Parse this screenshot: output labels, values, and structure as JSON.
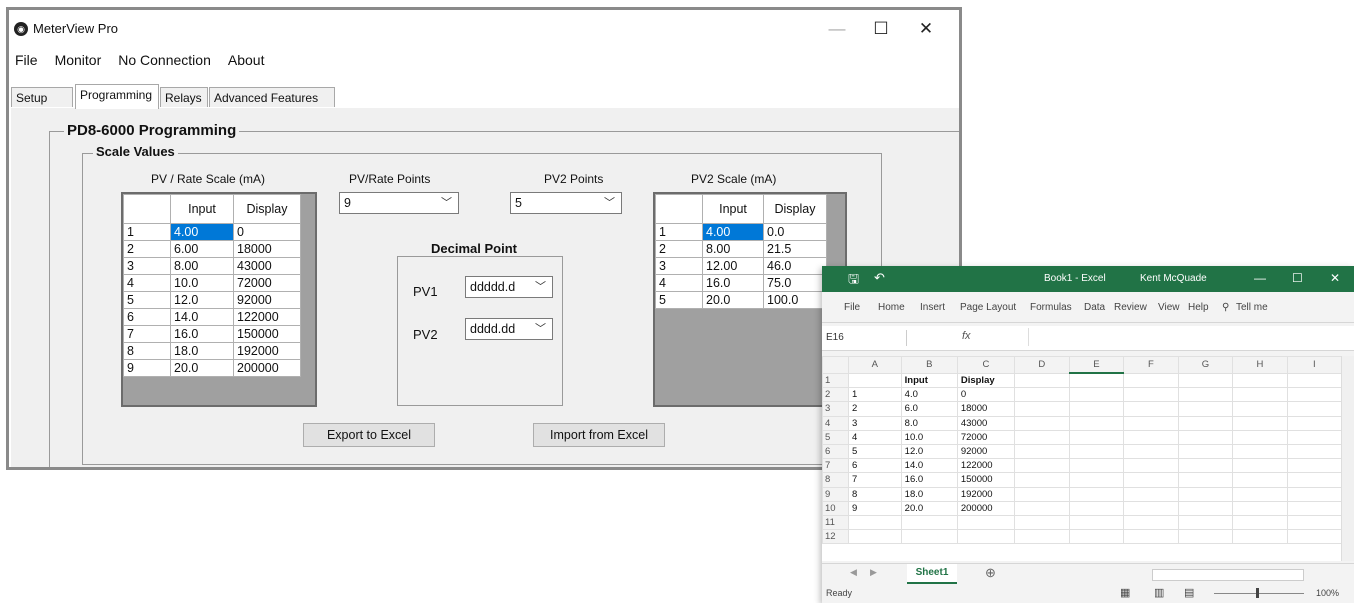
{
  "meterview": {
    "title": "MeterView Pro",
    "window_controls": {
      "minimize": "—",
      "maximize": "☐",
      "close": "✕"
    },
    "menu": [
      "File",
      "Monitor",
      "No Connection",
      "About"
    ],
    "tabs": [
      "Setup",
      "Programming",
      "Relays",
      "Advanced Features"
    ],
    "active_tab": "Programming",
    "programming_group": "PD8-6000 Programming",
    "scale_group": "Scale Values",
    "pv_scale": {
      "title": "PV / Rate Scale (mA)",
      "headers": [
        "",
        "Input",
        "Display"
      ],
      "rows": [
        [
          "1",
          "4.00",
          "0"
        ],
        [
          "2",
          "6.00",
          "18000"
        ],
        [
          "3",
          "8.00",
          "43000"
        ],
        [
          "4",
          "10.0",
          "72000"
        ],
        [
          "5",
          "12.0",
          "92000"
        ],
        [
          "6",
          "14.0",
          "122000"
        ],
        [
          "7",
          "16.0",
          "150000"
        ],
        [
          "8",
          "18.0",
          "192000"
        ],
        [
          "9",
          "20.0",
          "200000"
        ]
      ]
    },
    "pv_points": {
      "label": "PV/Rate Points",
      "value": "9"
    },
    "pv2_points": {
      "label": "PV2 Points",
      "value": "5"
    },
    "decimal_point": {
      "title": "Decimal Point",
      "pv1_label": "PV1",
      "pv1_value": "ddddd.d",
      "pv2_label": "PV2",
      "pv2_value": "dddd.dd"
    },
    "pv2_scale": {
      "title": "PV2 Scale (mA)",
      "headers": [
        "",
        "Input",
        "Display"
      ],
      "rows": [
        [
          "1",
          "4.00",
          "0.0"
        ],
        [
          "2",
          "8.00",
          "21.5"
        ],
        [
          "3",
          "12.00",
          "46.0"
        ],
        [
          "4",
          "16.0",
          "75.0"
        ],
        [
          "5",
          "20.0",
          "100.0"
        ]
      ]
    },
    "export_button": "Export to Excel",
    "import_button": "Import from Excel",
    "colors": {
      "selection": "#0078d7",
      "window_bg": "#f0f0f0"
    }
  },
  "excel": {
    "title": "Book1 - Excel",
    "user": "Kent McQuade",
    "ribbon_tabs": [
      "File",
      "Home",
      "Insert",
      "Page Layout",
      "Formulas",
      "Data",
      "Review",
      "View",
      "Help",
      "Tell me"
    ],
    "name_box": "E16",
    "formula_symbol": "fx",
    "columns": [
      "",
      "A",
      "B",
      "C",
      "D",
      "E",
      "F",
      "G",
      "H",
      "I"
    ],
    "rows": [
      [
        "1",
        "",
        "Input",
        "Display",
        "",
        "",
        "",
        "",
        "",
        ""
      ],
      [
        "2",
        "1",
        "4.0",
        "0",
        "",
        "",
        "",
        "",
        "",
        ""
      ],
      [
        "3",
        "2",
        "6.0",
        "18000",
        "",
        "",
        "",
        "",
        "",
        ""
      ],
      [
        "4",
        "3",
        "8.0",
        "43000",
        "",
        "",
        "",
        "",
        "",
        ""
      ],
      [
        "5",
        "4",
        "10.0",
        "72000",
        "",
        "",
        "",
        "",
        "",
        ""
      ],
      [
        "6",
        "5",
        "12.0",
        "92000",
        "",
        "",
        "",
        "",
        "",
        ""
      ],
      [
        "7",
        "6",
        "14.0",
        "122000",
        "",
        "",
        "",
        "",
        "",
        ""
      ],
      [
        "8",
        "7",
        "16.0",
        "150000",
        "",
        "",
        "",
        "",
        "",
        ""
      ],
      [
        "9",
        "8",
        "18.0",
        "192000",
        "",
        "",
        "",
        "",
        "",
        ""
      ],
      [
        "10",
        "9",
        "20.0",
        "200000",
        "",
        "",
        "",
        "",
        "",
        ""
      ],
      [
        "11",
        "",
        "",
        "",
        "",
        "",
        "",
        "",
        "",
        ""
      ],
      [
        "12",
        "",
        "",
        "",
        "",
        "",
        "",
        "",
        "",
        ""
      ]
    ],
    "sheet_tab": "Sheet1",
    "status": "Ready",
    "zoom": "100%",
    "colors": {
      "accent": "#217346"
    }
  }
}
